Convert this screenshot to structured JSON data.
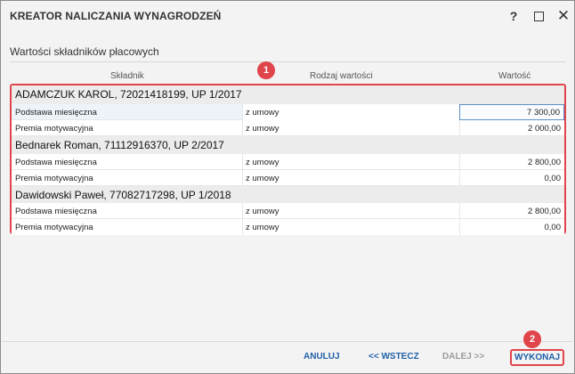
{
  "window": {
    "title": "KREATOR NALICZANIA WYNAGRODZEŃ",
    "help_icon": "question-mark",
    "maximize_icon": "square",
    "close_icon": "x"
  },
  "section": {
    "title": "Wartości składników płacowych"
  },
  "columns": {
    "skladnik": "Składnik",
    "rodzaj": "Rodzaj wartości",
    "wartosc": "Wartość"
  },
  "groups": [
    {
      "header": "ADAMCZUK KAROL, 72021418199, UP 1/2017",
      "rows": [
        {
          "name": "Podstawa miesięczna",
          "type": "z umowy",
          "value": "7 300,00"
        },
        {
          "name": "Premia motywacyjna",
          "type": "z umowy",
          "value": "2 000,00"
        }
      ]
    },
    {
      "header": "Bednarek Roman, 71112916370, UP 2/2017",
      "rows": [
        {
          "name": "Podstawa miesięczna",
          "type": "z umowy",
          "value": "2 800,00"
        },
        {
          "name": "Premia motywacyjna",
          "type": "z umowy",
          "value": "0,00"
        }
      ]
    },
    {
      "header": "Dawidowski Paweł, 77082717298, UP 1/2018",
      "rows": [
        {
          "name": "Podstawa miesięczna",
          "type": "z umowy",
          "value": "2 800,00"
        },
        {
          "name": "Premia motywacyjna",
          "type": "z umowy",
          "value": "0,00"
        }
      ]
    }
  ],
  "annotations": {
    "badge1": "1",
    "badge2": "2",
    "color": "#e0454b"
  },
  "footer": {
    "anuluj": "ANULUJ",
    "wstecz": "<< WSTECZ",
    "dalej": "DALEJ >>",
    "wykonaj": "WYKONAJ"
  },
  "colors": {
    "accent_text": "#1f5fa8",
    "disabled_text": "#9b9b9b",
    "focus_border": "#5b8fc4"
  }
}
